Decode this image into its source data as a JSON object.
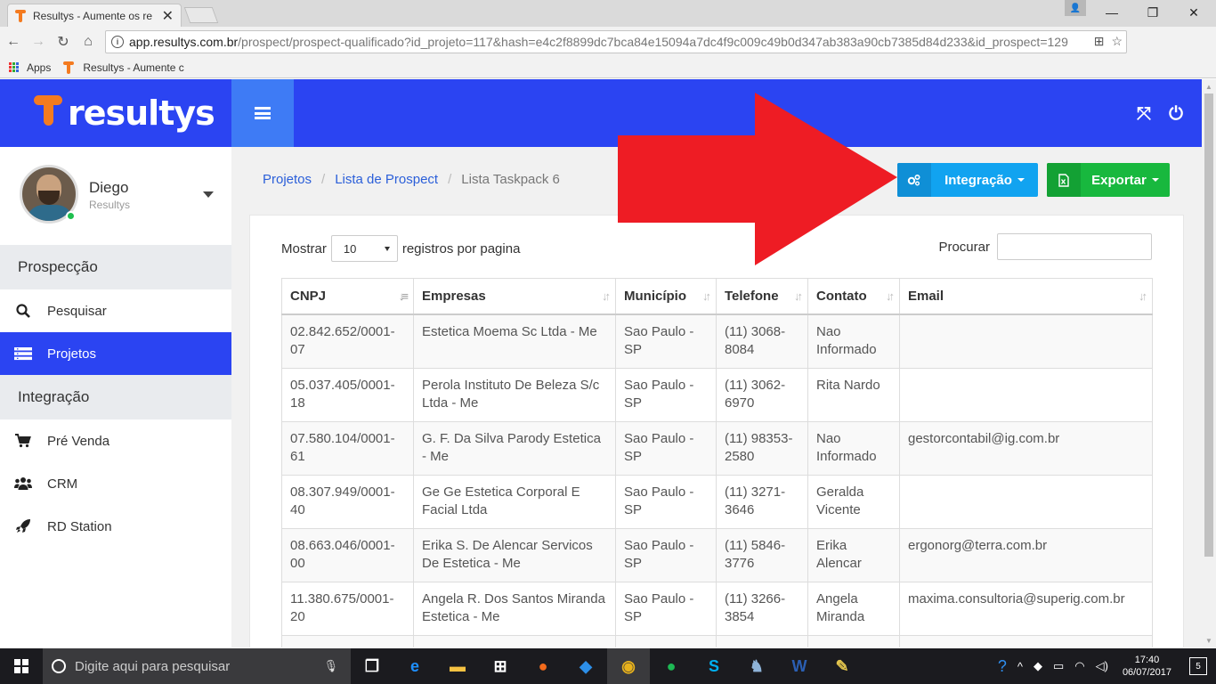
{
  "browser": {
    "tab_title": "Resultys - Aumente os re",
    "url_domain": "app.resultys.com.br",
    "url_path": "/prospect/prospect-qualificado?id_projeto=117&hash=e4c2f8899dc7bca84e15094a7dc4f9c009c49b0d347ab383a90cb7385d84d233&id_prospect=129",
    "bookmarks": {
      "apps_label": "Apps",
      "resultys_label": "Resultys - Aumente c"
    }
  },
  "header": {
    "logo_text": "resultys",
    "brand_color": "#2b44f2",
    "accent_color": "#f47b20"
  },
  "sidebar": {
    "user": {
      "name": "Diego",
      "org": "Resultys",
      "status": "online"
    },
    "sections": [
      {
        "label": "Prospecção"
      },
      {
        "label": "Integração"
      }
    ],
    "items": [
      {
        "label": "Pesquisar",
        "icon": "search-icon"
      },
      {
        "label": "Projetos",
        "icon": "list-icon",
        "active": true
      },
      {
        "label": "Pré Venda",
        "icon": "cart-icon"
      },
      {
        "label": "CRM",
        "icon": "users-icon"
      },
      {
        "label": "RD Station",
        "icon": "rocket-icon"
      }
    ]
  },
  "breadcrumb": {
    "items": [
      "Projetos",
      "Lista de Prospect"
    ],
    "current": "Lista Taskpack 6"
  },
  "actions": {
    "integracao_label": "Integração",
    "exportar_label": "Exportar"
  },
  "table_controls": {
    "show_prefix": "Mostrar",
    "page_length": "10",
    "show_suffix": "registros por pagina",
    "search_label": "Procurar",
    "search_value": ""
  },
  "table": {
    "columns": [
      "CNPJ",
      "Empresas",
      "Município",
      "Telefone",
      "Contato",
      "Email"
    ],
    "rows": [
      {
        "cnpj": "02.842.652/0001-07",
        "empresa": "Estetica Moema Sc Ltda - Me",
        "municipio": "Sao Paulo - SP",
        "telefone": "(11) 3068-8084",
        "contato": "Nao Informado",
        "email": ""
      },
      {
        "cnpj": "05.037.405/0001-18",
        "empresa": "Perola Instituto De Beleza S/c Ltda - Me",
        "municipio": "Sao Paulo - SP",
        "telefone": "(11) 3062-6970",
        "contato": "Rita Nardo",
        "email": ""
      },
      {
        "cnpj": "07.580.104/0001-61",
        "empresa": "G. F. Da Silva Parody Estetica - Me",
        "municipio": "Sao Paulo - SP",
        "telefone": "(11) 98353-2580",
        "contato": "Nao Informado",
        "email": "gestorcontabil@ig.com.br"
      },
      {
        "cnpj": "08.307.949/0001-40",
        "empresa": "Ge Ge Estetica Corporal E Facial Ltda",
        "municipio": "Sao Paulo - SP",
        "telefone": "(11) 3271-3646",
        "contato": "Geralda Vicente",
        "email": ""
      },
      {
        "cnpj": "08.663.046/0001-00",
        "empresa": "Erika S. De Alencar Servicos De Estetica - Me",
        "municipio": "Sao Paulo - SP",
        "telefone": "(11) 5846-3776",
        "contato": "Erika Alencar",
        "email": "ergonorg@terra.com.br"
      },
      {
        "cnpj": "11.380.675/0001-20",
        "empresa": "Angela R. Dos Santos Miranda Estetica - Me",
        "municipio": "Sao Paulo - SP",
        "telefone": "(11) 3266-3854",
        "contato": "Angela Miranda",
        "email": "maxima.consultoria@superig.com.br"
      }
    ]
  },
  "annotation": {
    "arrow_color": "#ee1c24"
  },
  "taskbar": {
    "search_placeholder": "Digite aqui para pesquisar",
    "time": "17:40",
    "date": "06/07/2017",
    "notification_count": "5"
  }
}
